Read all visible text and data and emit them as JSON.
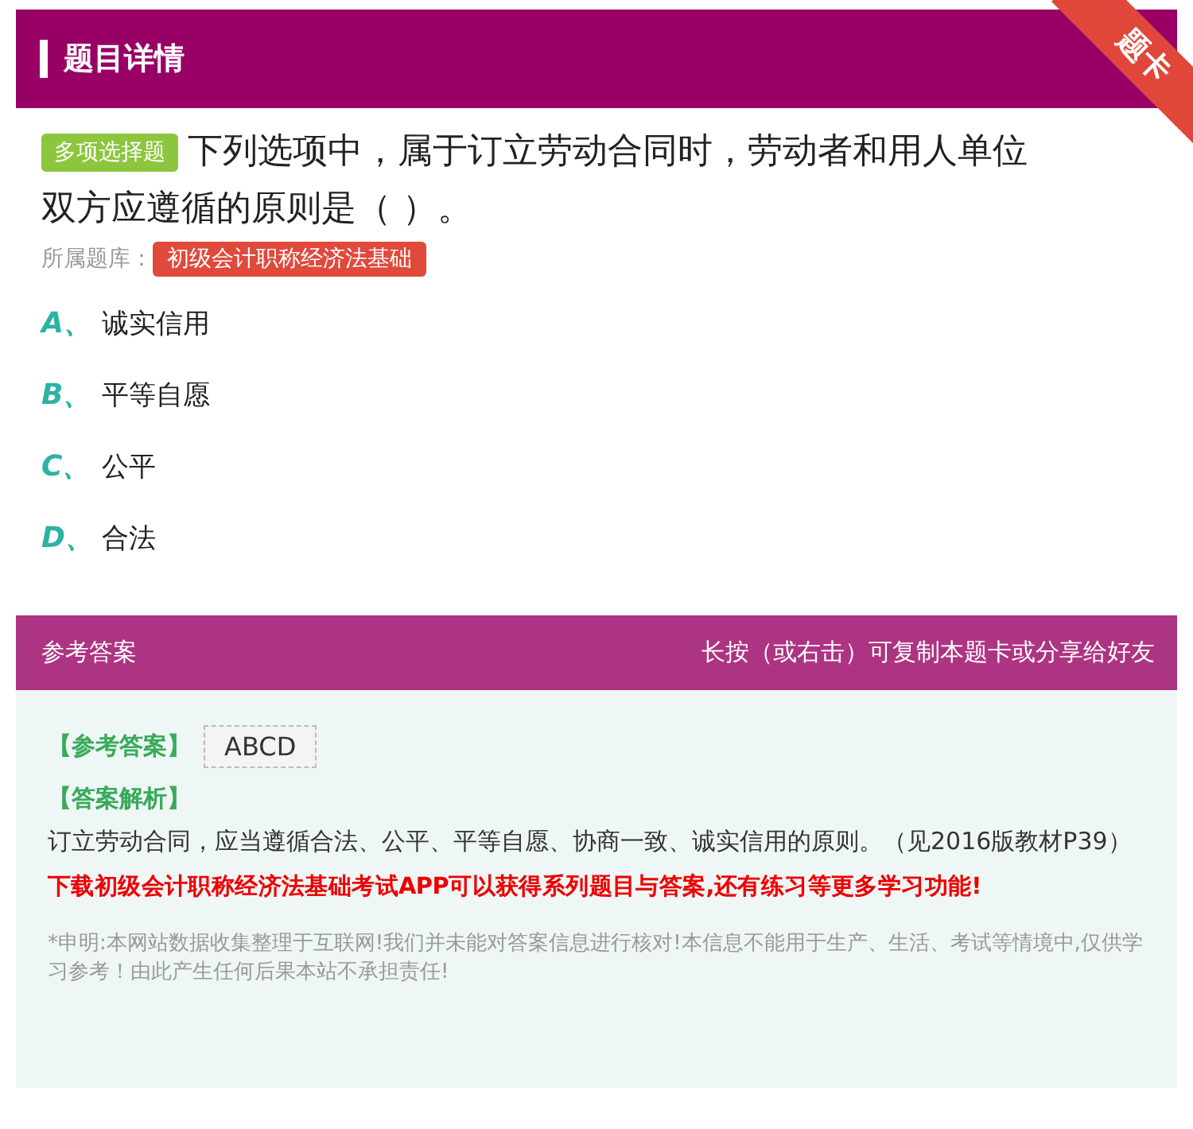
{
  "header": {
    "title": "题目详情",
    "ribbon": "题卡"
  },
  "question": {
    "type_badge": "多项选择题",
    "text_lines": [
      "下列选项中，属于订立劳动合同时，劳动者和用人单位",
      "双方应遵循的原则是（ ）。"
    ],
    "bank_label": "所属题库：",
    "bank": "初级会计职称经济法基础"
  },
  "options": [
    {
      "letter": "A、",
      "text": "诚实信用"
    },
    {
      "letter": "B、",
      "text": "平等自愿"
    },
    {
      "letter": "C、",
      "text": "公平"
    },
    {
      "letter": "D、",
      "text": "合法"
    }
  ],
  "answer_bar": {
    "title": "参考答案",
    "hint": "长按（或右击）可复制本题卡或分享给好友"
  },
  "answer": {
    "answer_label": "【参考答案】",
    "answer": "ABCD",
    "analysis_label": "【答案解析】",
    "analysis": "订立劳动合同，应当遵循合法、公平、平等自愿、协商一致、诚实信用的原则。（见2016版教材P39）",
    "promo": "下载初级会计职称经济法基础考试APP可以获得系列题目与答案,还有练习等更多学习功能!",
    "disclaimer": "*申明:本网站数据收集整理于互联网!我们并未能对答案信息进行核对!本信息不能用于生产、生活、考试等情境中,仅供学习参考！由此产生任何后果本站不承担责任!"
  }
}
